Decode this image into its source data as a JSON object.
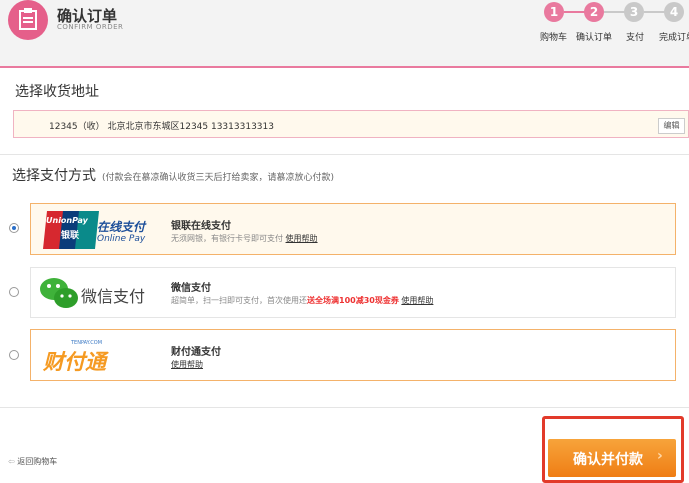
{
  "header": {
    "title": "确认订单",
    "subtitle": "CONFIRM ORDER",
    "steps": [
      {
        "num": "1",
        "label": "购物车"
      },
      {
        "num": "2",
        "label": "确认订单"
      },
      {
        "num": "3",
        "label": "支付"
      },
      {
        "num": "4",
        "label": "完成订单"
      }
    ],
    "active_color": "#e9799e",
    "inactive_color": "#c9c9c9"
  },
  "address": {
    "section_title": "选择收货地址",
    "line": "12345（收）  北京北京市东城区12345   13313313313",
    "edit_label": "编辑"
  },
  "payment": {
    "section_title": "选择支付方式",
    "section_note": "(付款会在慕凉确认收货三天后打给卖家，请慕凉放心付款)",
    "options": [
      {
        "name": "银联在线支付",
        "desc": "无须网银，有银行卡号即可支付",
        "help": "使用帮助",
        "logo_text": "在线支付",
        "logo_sub": "Online Pay",
        "logo_brand": "UnionPay",
        "logo_brand_cn": "银联",
        "selected": true
      },
      {
        "name": "微信支付",
        "desc": "超简单，扫一扫即可支付，首次使用还",
        "promo": "送全场满100减30现金券",
        "help": "使用帮助",
        "logo_text": "微信支付",
        "selected": false
      },
      {
        "name": "财付通支付",
        "help": "使用帮助",
        "logo_text": "财付通",
        "logo_sub": "TENPAY.COM",
        "selected": false
      }
    ]
  },
  "footer": {
    "back_label": "返回购物车",
    "confirm_label": "确认并付款",
    "confirm_icon": "chevron-right-icon"
  }
}
